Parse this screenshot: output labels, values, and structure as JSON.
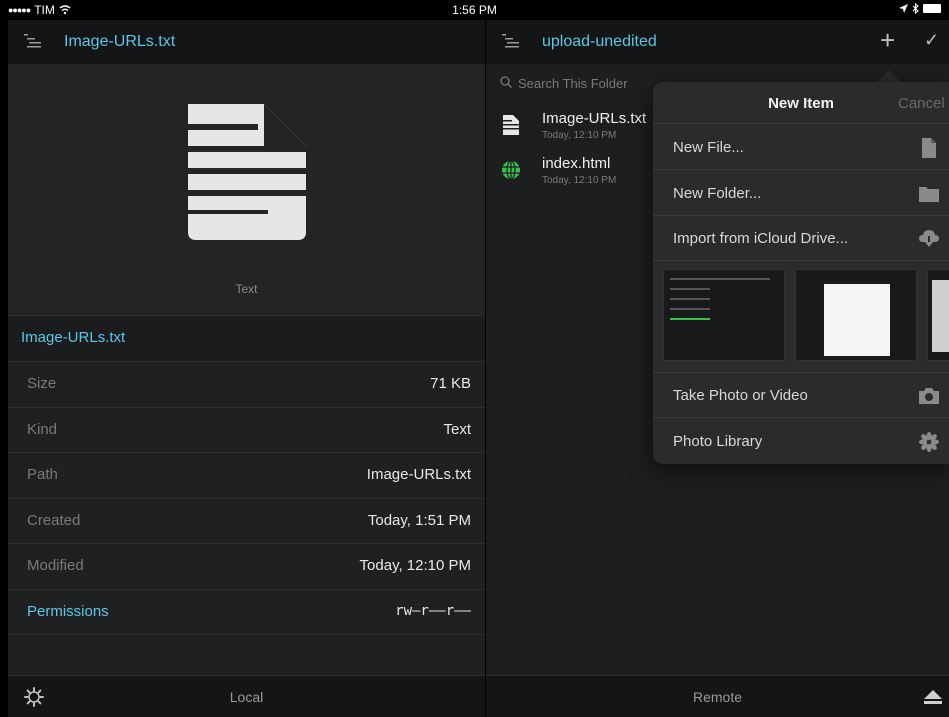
{
  "status_bar": {
    "carrier": "TIM",
    "time": "1:56 PM"
  },
  "left_pane": {
    "header_title": "Image-URLs.txt",
    "preview_kind": "Text",
    "file_name": "Image-URLs.txt",
    "info": [
      {
        "label": "Size",
        "value": "71 KB"
      },
      {
        "label": "Kind",
        "value": "Text"
      },
      {
        "label": "Path",
        "value": "Image-URLs.txt"
      },
      {
        "label": "Created",
        "value": "Today, 1:51 PM"
      },
      {
        "label": "Modified",
        "value": "Today, 12:10 PM"
      },
      {
        "label": "Permissions",
        "value": "rw–r––r––"
      }
    ],
    "footer_label": "Local"
  },
  "right_pane": {
    "header_title": "upload-unedited",
    "search_placeholder": "Search This Folder",
    "files": [
      {
        "name": "Image-URLs.txt",
        "date": "Today, 12:10 PM",
        "icon": "text-file-icon"
      },
      {
        "name": "index.html",
        "date": "Today, 12:10 PM",
        "icon": "globe-icon"
      }
    ],
    "footer_label": "Remote"
  },
  "popover": {
    "title": "New Item",
    "cancel": "Cancel",
    "items": [
      {
        "label": "New File...",
        "icon": "file-icon"
      },
      {
        "label": "New Folder...",
        "icon": "folder-icon"
      },
      {
        "label": "Import from iCloud Drive...",
        "icon": "cloud-download-icon"
      },
      {
        "label": "Take Photo or Video",
        "icon": "camera-icon"
      },
      {
        "label": "Photo Library",
        "icon": "photos-icon"
      }
    ]
  },
  "colors": {
    "accent": "#5ac8e6",
    "background": "#1f2021",
    "header": "#141516"
  }
}
